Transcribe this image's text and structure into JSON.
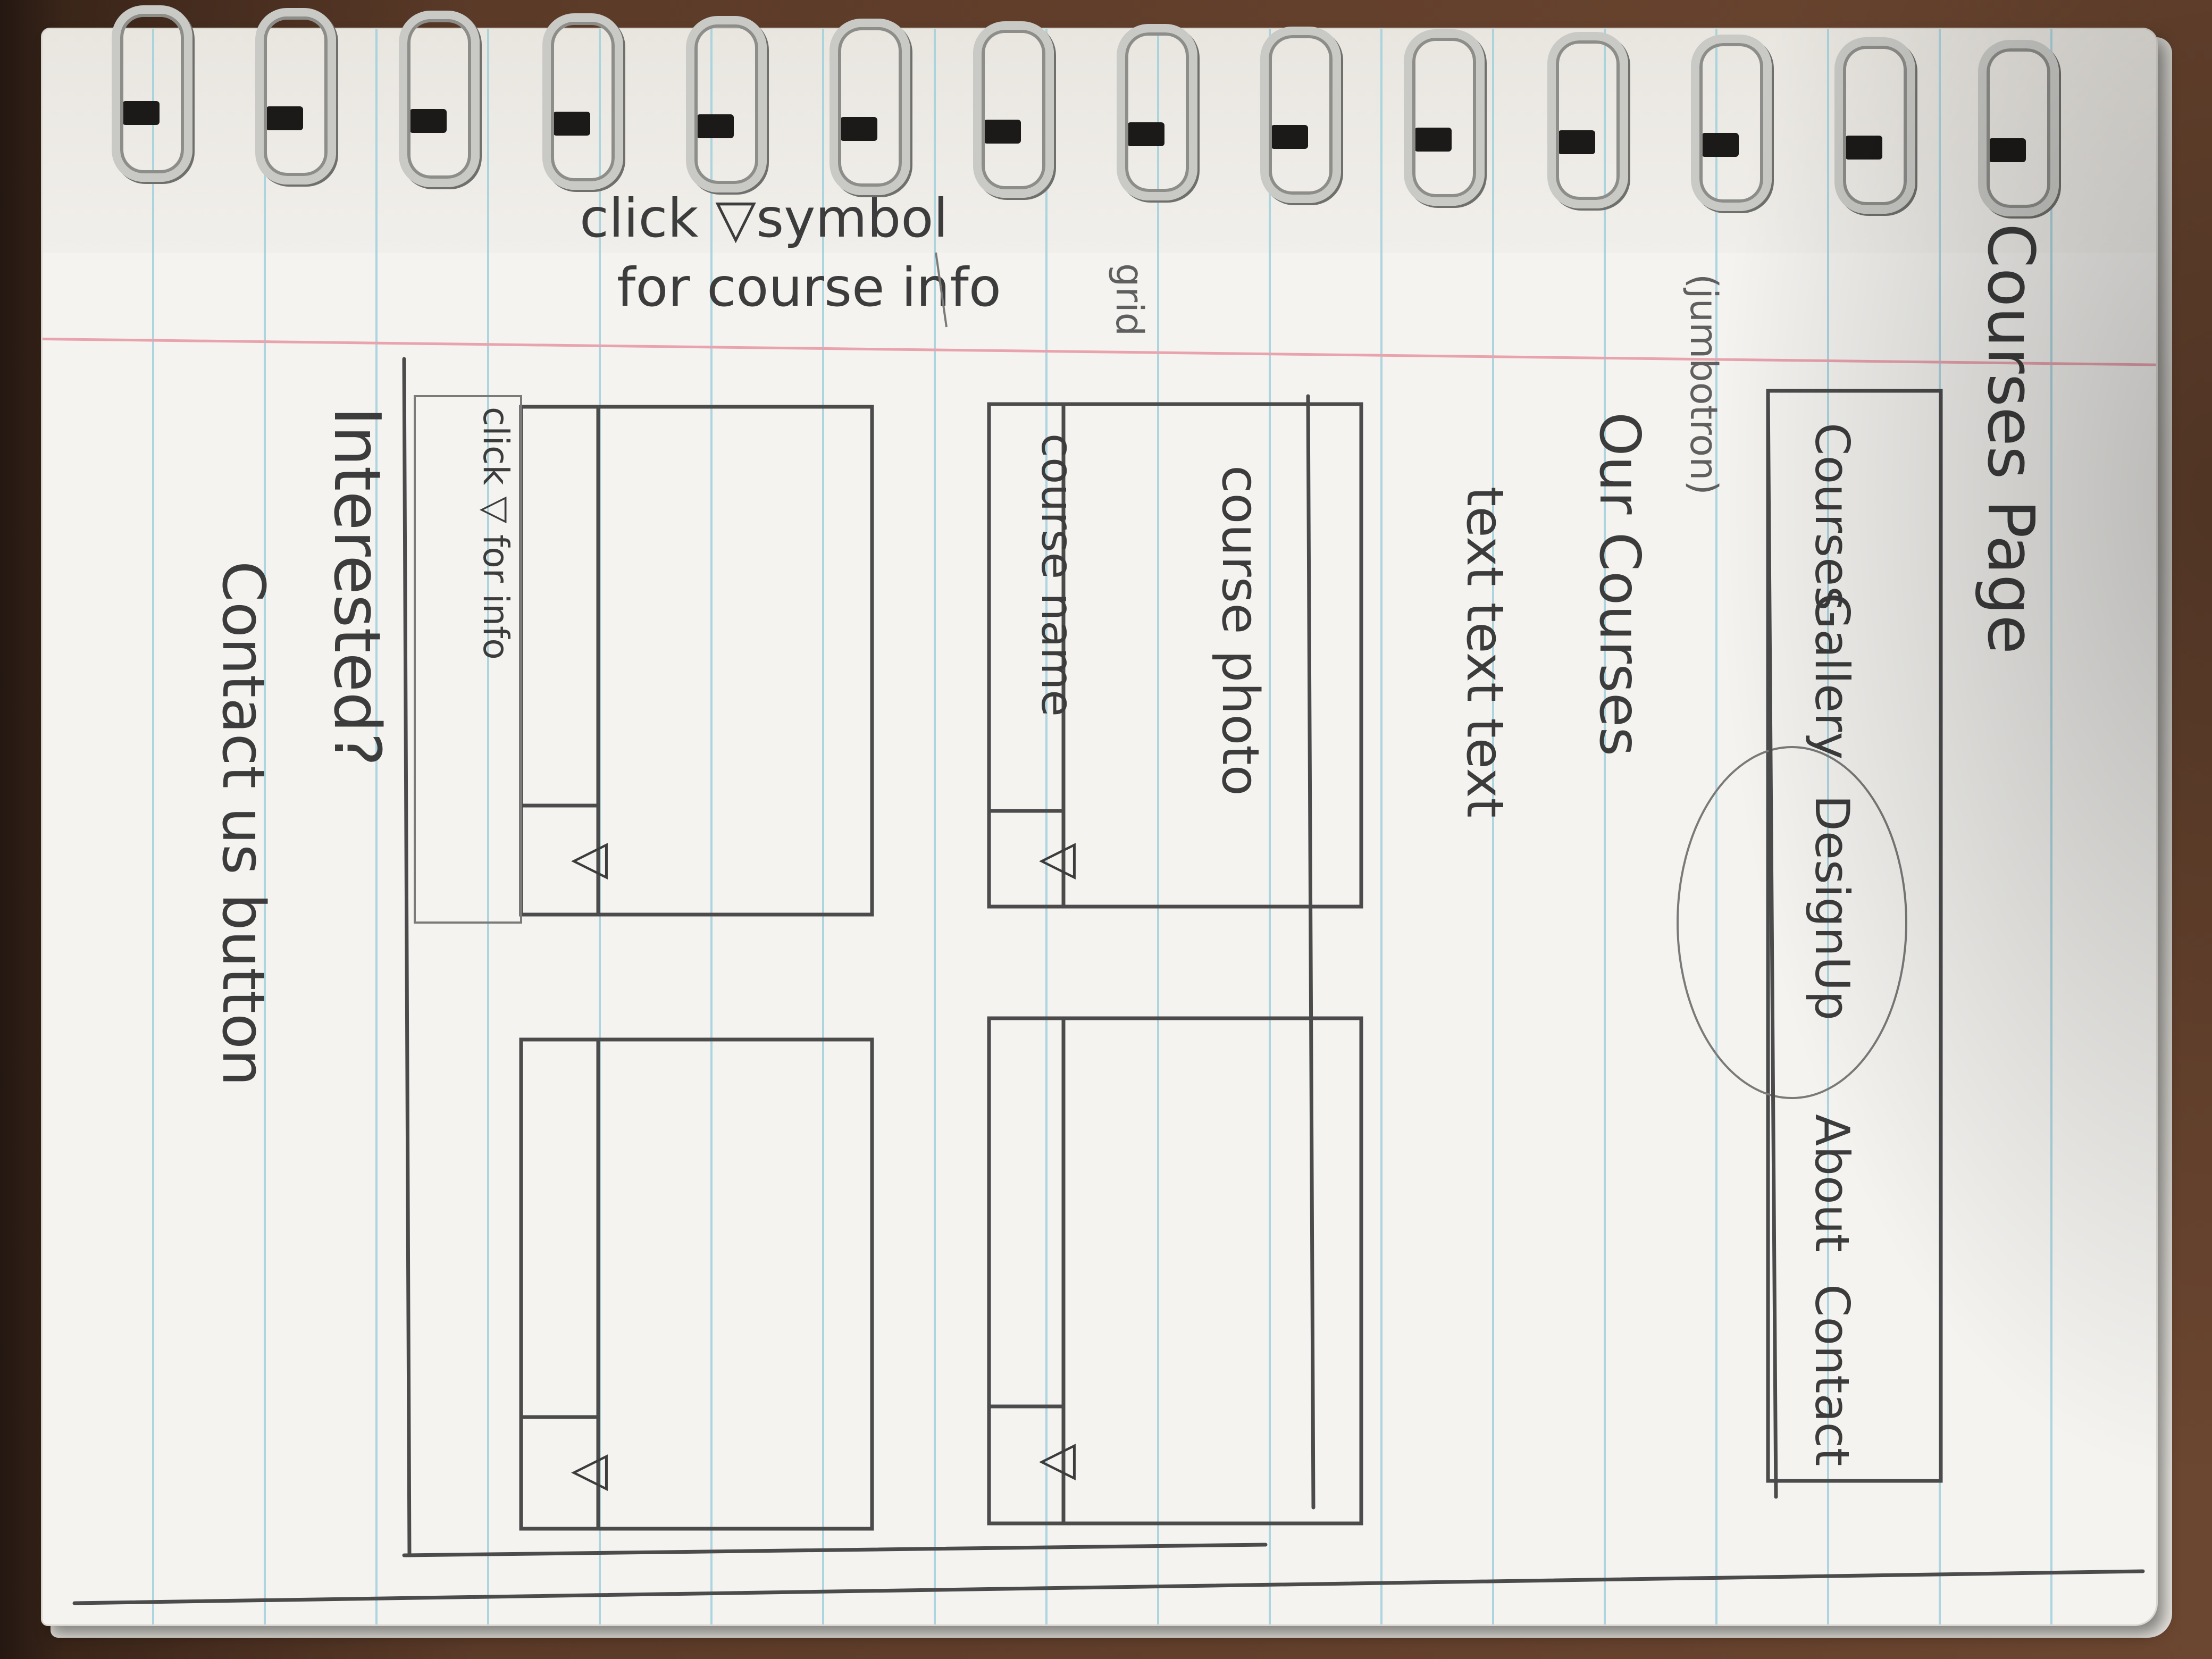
{
  "sketch": {
    "title": "Courses Page",
    "nav": {
      "items": [
        "Courses",
        "Gallery",
        "DesignUp",
        "About",
        "Contact"
      ]
    },
    "jumbotron": {
      "note": "(jumbotron)",
      "heading": "Our Courses",
      "body": "text text text"
    },
    "grid_note": "grid",
    "instruction": [
      "click ▽symbol",
      "for course info"
    ],
    "cards": [
      {
        "photo": "course photo",
        "name": "course name",
        "toggle": "▽"
      },
      {
        "photo": "",
        "name": "",
        "toggle": "▽"
      },
      {
        "photo": "",
        "name": "click ▽ for info",
        "toggle": "▽"
      },
      {
        "photo": "",
        "name": "",
        "toggle": "▽"
      }
    ],
    "footer": {
      "question": "Interested?",
      "button": "Contact us button"
    }
  }
}
